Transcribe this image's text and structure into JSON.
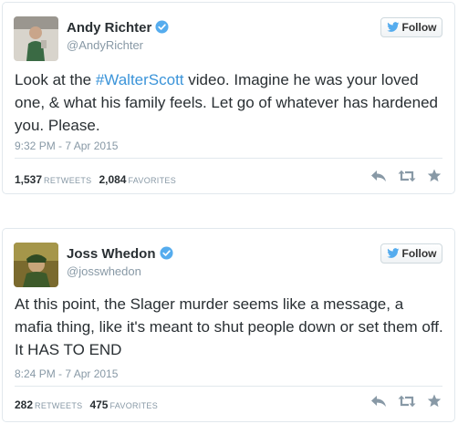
{
  "colors": {
    "link": "#3b94d9",
    "verified": "#55acee",
    "muted": "#8899a6",
    "text": "#292f33",
    "border": "#e1e8ed"
  },
  "tweets": [
    {
      "name": "Andy Richter",
      "handle": "@AndyRichter",
      "follow_label": "Follow",
      "text_before": "Look at the ",
      "hashtag": "#WalterScott",
      "text_after": " video. Imagine he was your loved one, & what his family feels. Let go of whatever has hardened you. Please.",
      "timestamp": "9:32 PM - 7 Apr 2015",
      "retweets": "1,537",
      "retweets_label": "RETWEETS",
      "favorites": "2,084",
      "favorites_label": "FAVORITES",
      "icons": [
        "reply-icon",
        "retweet-icon",
        "favorite-star-icon"
      ]
    },
    {
      "name": "Joss Whedon",
      "handle": "@josswhedon",
      "follow_label": "Follow",
      "text": "At this point, the Slager murder seems like a message, a mafia thing, like it's meant to shut people down or set them off. It HAS TO END",
      "timestamp": "8:24 PM - 7 Apr 2015",
      "retweets": "282",
      "retweets_label": "RETWEETS",
      "favorites": "475",
      "favorites_label": "FAVORITES",
      "icons": [
        "reply-icon",
        "retweet-icon",
        "favorite-star-icon"
      ]
    }
  ]
}
